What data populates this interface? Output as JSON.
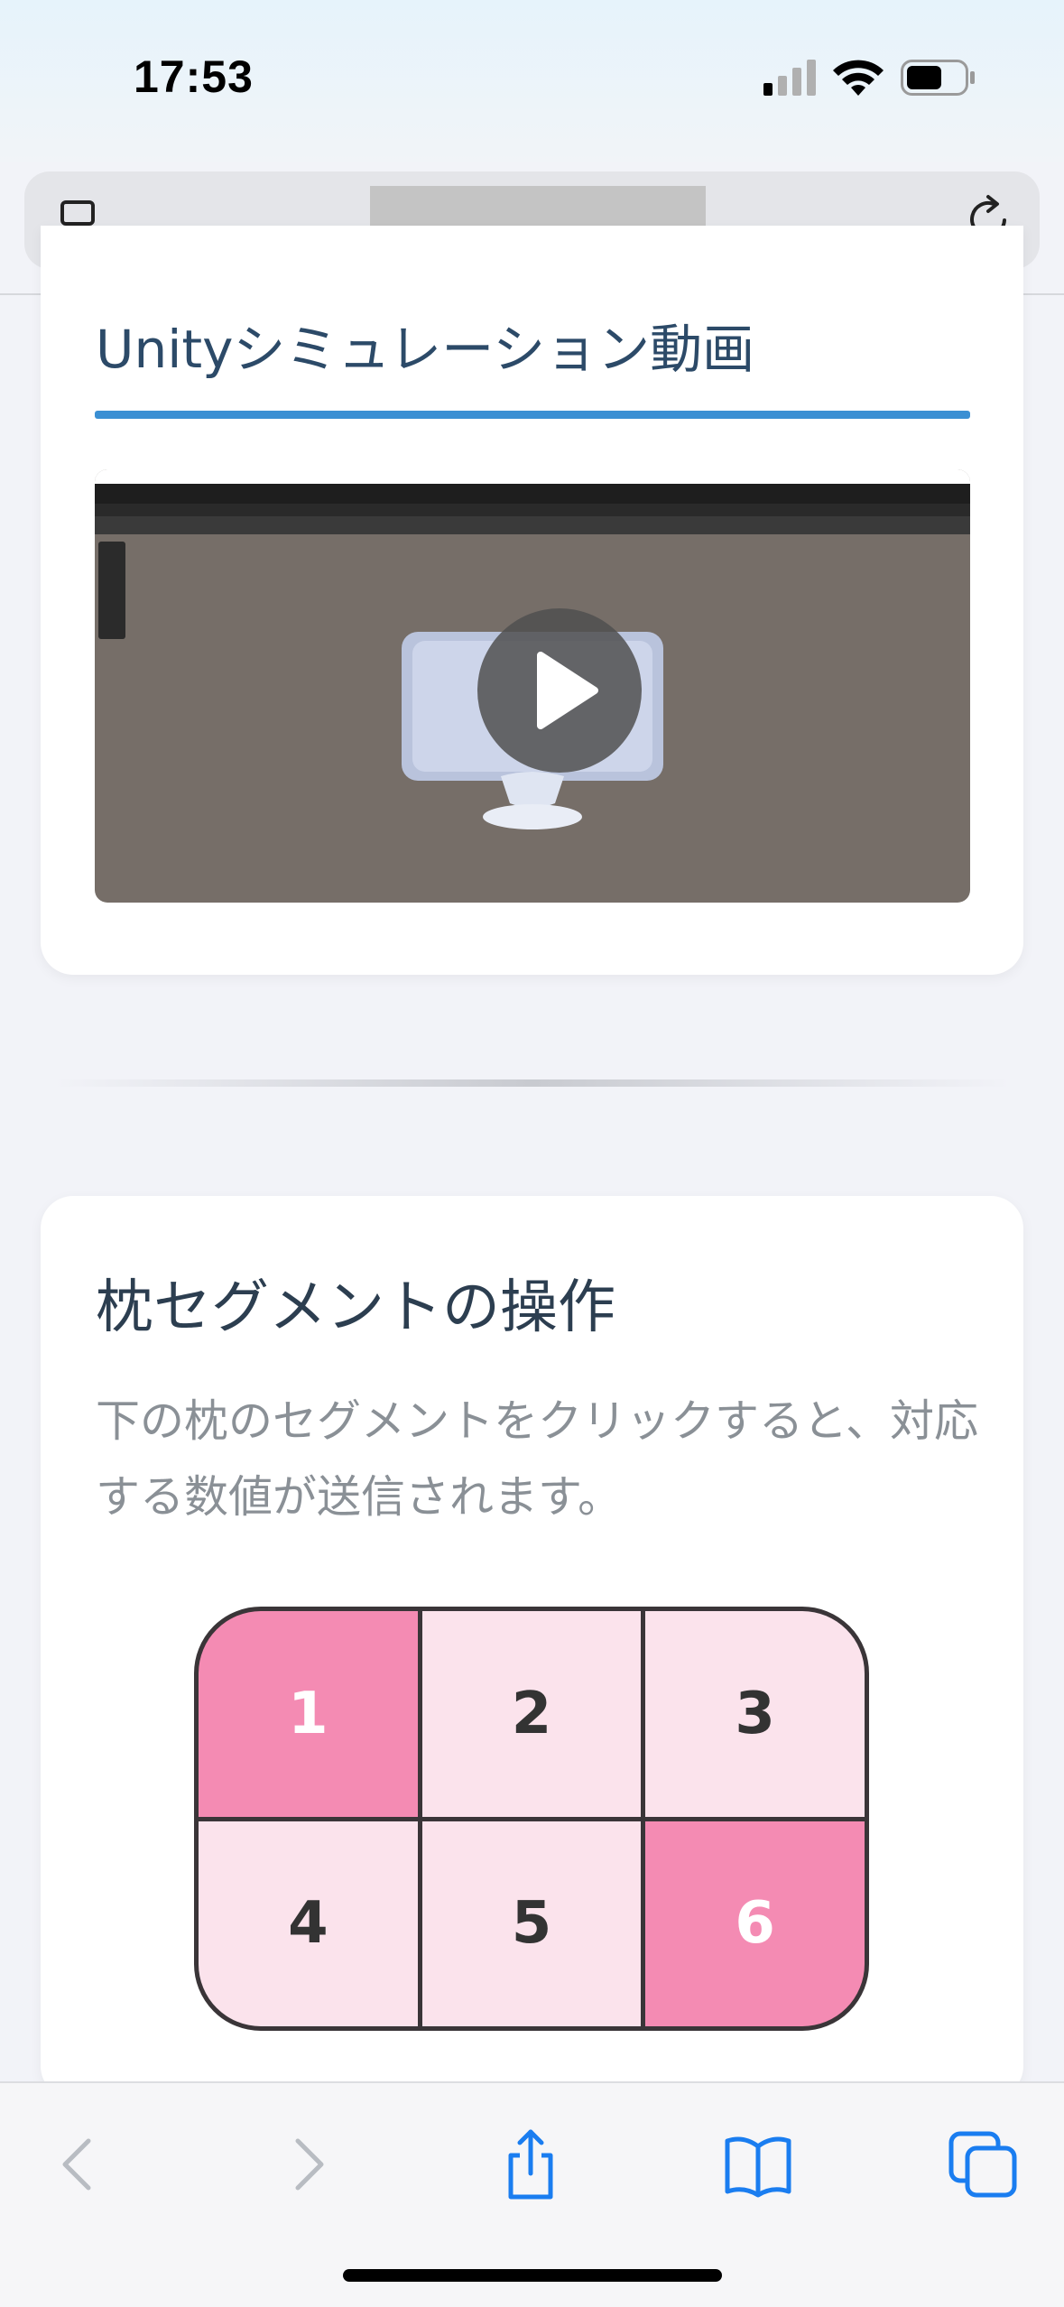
{
  "status_bar": {
    "time": "17:53"
  },
  "browser": {
    "url_redacted": true
  },
  "video_section": {
    "title": "Unityシミュレーション動画"
  },
  "pillow_section": {
    "title": "枕セグメントの操作",
    "description": "下の枕のセグメントをクリックすると、対応する数値が送信されます。",
    "segments": [
      {
        "label": "1",
        "active": true
      },
      {
        "label": "2",
        "active": false
      },
      {
        "label": "3",
        "active": false
      },
      {
        "label": "4",
        "active": false
      },
      {
        "label": "5",
        "active": false
      },
      {
        "label": "6",
        "active": true
      }
    ]
  },
  "colors": {
    "accent_blue": "#3a8fd3",
    "segment_active": "#f48bb3",
    "segment_inactive": "#fbe3ec",
    "toolbar_icon": "#1a7df0"
  },
  "icons": [
    "reader-icon",
    "reload-icon",
    "play-icon",
    "back-icon",
    "forward-icon",
    "share-icon",
    "bookmarks-icon",
    "tabs-icon"
  ]
}
